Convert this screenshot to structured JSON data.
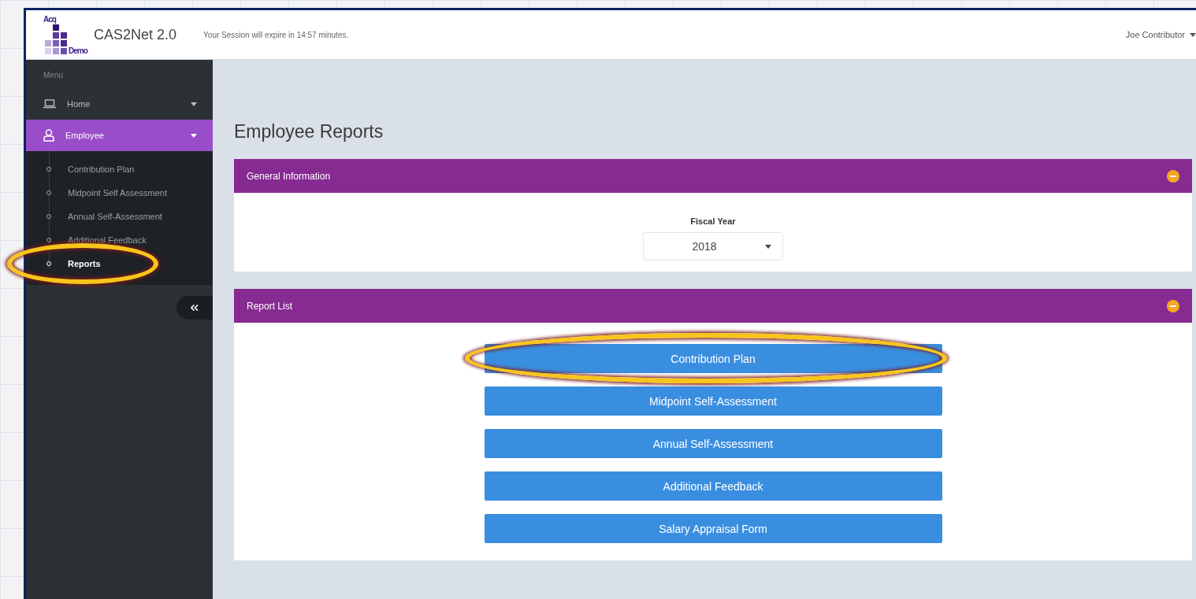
{
  "header": {
    "logo": {
      "top": "Acq",
      "bottom": "Demo"
    },
    "app_name": "CAS2Net 2.0",
    "session_notice": "Your Session will expire in 14:57 minutes.",
    "user_menu": "Joe Contributor"
  },
  "sidebar": {
    "heading": "Menu",
    "items": [
      {
        "label": "Home",
        "selected": false
      },
      {
        "label": "Employee",
        "selected": true,
        "children": [
          {
            "label": "Contribution Plan",
            "selected": false,
            "highlighted": false
          },
          {
            "label": "Midpoint Self Assessment",
            "selected": false,
            "highlighted": false
          },
          {
            "label": "Annual Self-Assessment",
            "selected": false,
            "highlighted": false
          },
          {
            "label": "Additional Feedback",
            "selected": false,
            "highlighted": false
          },
          {
            "label": "Reports",
            "selected": true,
            "highlighted": true
          }
        ]
      }
    ]
  },
  "page_title": "Employee Reports",
  "panels": [
    {
      "kind": "filter",
      "title": "General Information",
      "field": {
        "label": "Fiscal Year",
        "value": "2018"
      }
    },
    {
      "kind": "buttons",
      "title": "Report List",
      "buttons": [
        {
          "label": "Contribution Plan",
          "highlighted": true
        },
        {
          "label": "Midpoint Self-Assessment",
          "highlighted": false
        },
        {
          "label": "Annual Self-Assessment",
          "highlighted": false
        },
        {
          "label": "Additional Feedback",
          "highlighted": false
        },
        {
          "label": "Salary Appraisal Form",
          "highlighted": false
        }
      ]
    }
  ]
}
